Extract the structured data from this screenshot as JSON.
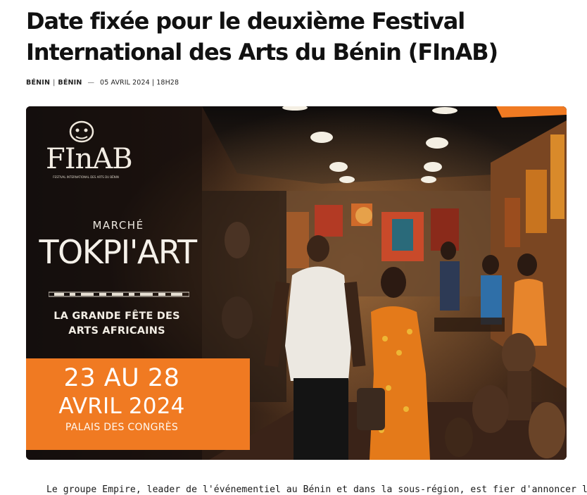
{
  "article": {
    "title": "Date fixée pour le deuxième Festival International des Arts du Bénin (FInAB)",
    "meta": {
      "category_1": "BÉNIN",
      "separator": "|",
      "category_2": "BÉNIN",
      "dash": "—",
      "date": "05 AVRIL 2024 | 18H28"
    },
    "hero": {
      "logo_word": "FInAB",
      "logo_subtitle": "FESTIVAL INTERNATIONAL DES ARTS DU BÉNIN",
      "marche": "MARCHÉ",
      "event_name": "TOKPI'ART",
      "tagline_1": "LA GRANDE FÊTE DES",
      "tagline_2": "ARTS AFRICAINS",
      "dates": "23 AU 28",
      "month_year": "AVRIL 2024",
      "venue": "PALAIS DES CONGRÈS",
      "accent_color": "#f07a22"
    },
    "lead_text": "Le groupe Empire, leader de l'événementiel au Bénin et dans la sous-région, est fier d'annoncer la"
  }
}
